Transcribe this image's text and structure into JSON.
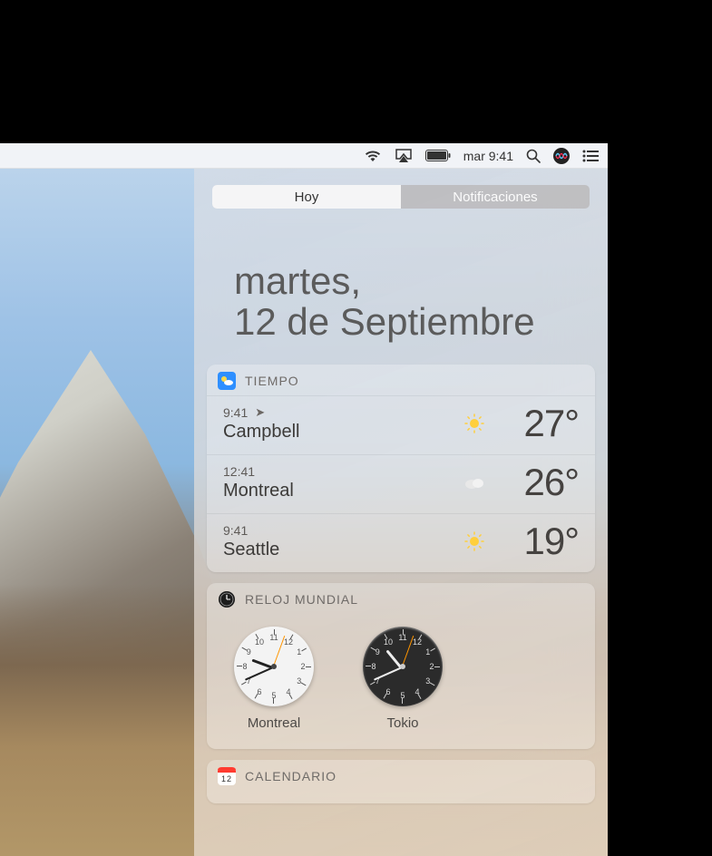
{
  "menubar": {
    "datetime": "mar 9:41"
  },
  "tabs": {
    "today": "Hoy",
    "notifications": "Notificaciones"
  },
  "date": {
    "line1": "martes,",
    "line2": "12 de Septiembre"
  },
  "weather": {
    "title": "TIEMPO",
    "rows": [
      {
        "time": "9:41",
        "city": "Campbell",
        "temp": "27°",
        "cond": "sunny",
        "current_location": true
      },
      {
        "time": "12:41",
        "city": "Montreal",
        "temp": "26°",
        "cond": "cloudy",
        "current_location": false
      },
      {
        "time": "9:41",
        "city": "Seattle",
        "temp": "19°",
        "cond": "sunny",
        "current_location": false
      }
    ]
  },
  "worldclock": {
    "title": "RELOJ MUNDIAL",
    "clocks": [
      {
        "city": "Montreal",
        "mode": "day",
        "hour": 9,
        "minute": 41
      },
      {
        "city": "Tokio",
        "mode": "night",
        "hour": 10,
        "minute": 41
      }
    ]
  },
  "calendar": {
    "title": "CALENDARIO"
  }
}
